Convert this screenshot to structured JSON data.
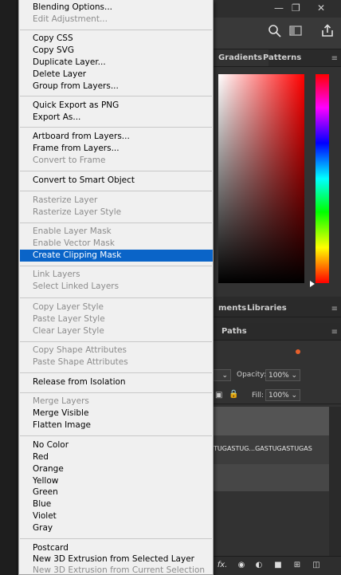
{
  "menu": {
    "items": [
      {
        "label": "Blending Options...",
        "enabled": true
      },
      {
        "label": "Edit Adjustment...",
        "enabled": false
      },
      {
        "label": "Copy CSS",
        "enabled": true
      },
      {
        "label": "Copy SVG",
        "enabled": true
      },
      {
        "label": "Duplicate Layer...",
        "enabled": true
      },
      {
        "label": "Delete Layer",
        "enabled": true
      },
      {
        "label": "Group from Layers...",
        "enabled": true
      },
      {
        "label": "Quick Export as PNG",
        "enabled": true
      },
      {
        "label": "Export As...",
        "enabled": true
      },
      {
        "label": "Artboard from Layers...",
        "enabled": true
      },
      {
        "label": "Frame from Layers...",
        "enabled": true
      },
      {
        "label": "Convert to Frame",
        "enabled": false
      },
      {
        "label": "Convert to Smart Object",
        "enabled": true
      },
      {
        "label": "Rasterize Layer",
        "enabled": false
      },
      {
        "label": "Rasterize Layer Style",
        "enabled": false
      },
      {
        "label": "Enable Layer Mask",
        "enabled": false
      },
      {
        "label": "Enable Vector Mask",
        "enabled": false
      },
      {
        "label": "Create Clipping Mask",
        "enabled": true,
        "highlighted": true
      },
      {
        "label": "Link Layers",
        "enabled": false
      },
      {
        "label": "Select Linked Layers",
        "enabled": false
      },
      {
        "label": "Copy Layer Style",
        "enabled": false
      },
      {
        "label": "Paste Layer Style",
        "enabled": false
      },
      {
        "label": "Clear Layer Style",
        "enabled": false
      },
      {
        "label": "Copy Shape Attributes",
        "enabled": false
      },
      {
        "label": "Paste Shape Attributes",
        "enabled": false
      },
      {
        "label": "Release from Isolation",
        "enabled": true
      },
      {
        "label": "Merge Layers",
        "enabled": false
      },
      {
        "label": "Merge Visible",
        "enabled": true
      },
      {
        "label": "Flatten Image",
        "enabled": true
      },
      {
        "label": "No Color",
        "enabled": true
      },
      {
        "label": "Red",
        "enabled": true
      },
      {
        "label": "Orange",
        "enabled": true
      },
      {
        "label": "Yellow",
        "enabled": true
      },
      {
        "label": "Green",
        "enabled": true
      },
      {
        "label": "Blue",
        "enabled": true
      },
      {
        "label": "Violet",
        "enabled": true
      },
      {
        "label": "Gray",
        "enabled": true
      },
      {
        "label": "Postcard",
        "enabled": true
      },
      {
        "label": "New 3D Extrusion from Selected Layer",
        "enabled": true
      },
      {
        "label": "New 3D Extrusion from Current Selection",
        "enabled": false
      }
    ]
  },
  "color_panel": {
    "tabs": [
      "Gradients",
      "Patterns"
    ],
    "base_color": "#ff0000"
  },
  "libraries_panel": {
    "tabs": [
      "ments",
      "Libraries"
    ]
  },
  "layers_panel": {
    "tabs": [
      "Paths"
    ],
    "opacity_label": "Opacity:",
    "opacity_value": "100%",
    "fill_label": "Fill:",
    "fill_value": "100%",
    "layer_name": "TUGASTUG...GASTUGASTUGAS"
  },
  "colors": {
    "menu_highlight": "#0a64c8",
    "menu_bg": "#f0f0f0",
    "panel_bg": "#323232"
  }
}
